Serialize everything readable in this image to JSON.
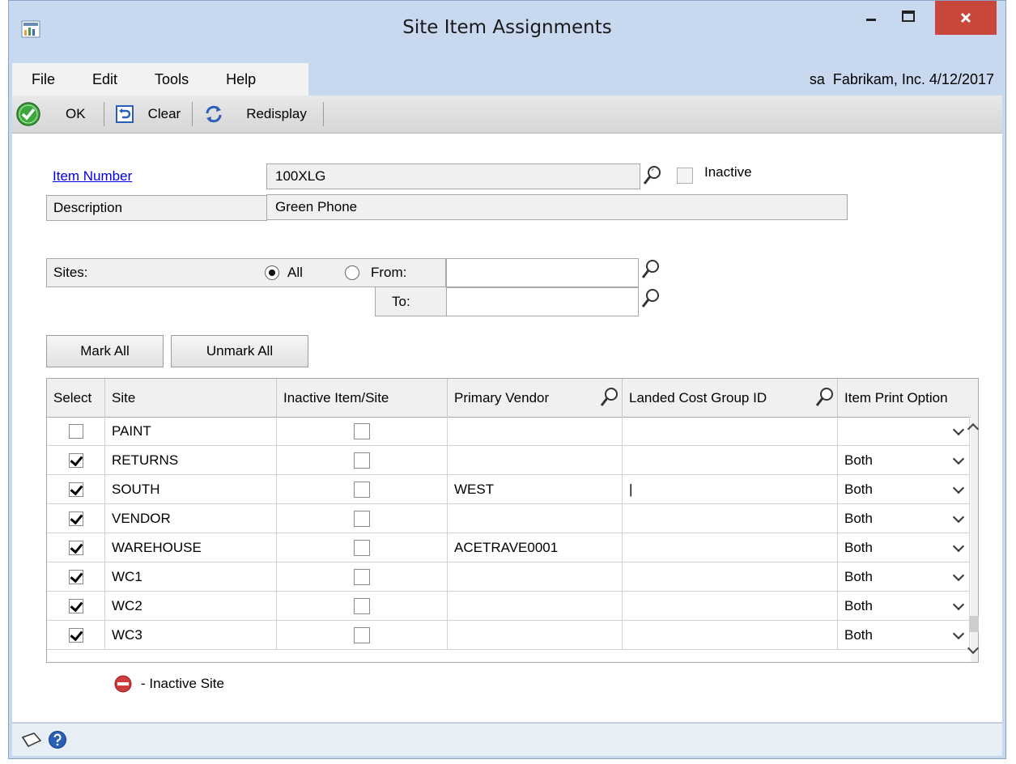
{
  "window": {
    "title": "Site Item Assignments"
  },
  "menu": {
    "items": [
      {
        "label": "File"
      },
      {
        "label": "Edit"
      },
      {
        "label": "Tools"
      },
      {
        "label": "Help"
      }
    ],
    "user_info": "sa  Fabrikam, Inc. 4/12/2017"
  },
  "toolbar": {
    "ok_label": "OK",
    "clear_label": "Clear",
    "redisplay_label": "Redisplay"
  },
  "form": {
    "item_number_label": "Item Number",
    "item_number_value": "100XLG",
    "inactive_label": "Inactive",
    "inactive_checked": false,
    "description_label": "Description",
    "description_value": "Green Phone",
    "sites_label": "Sites:",
    "all_label": "All",
    "from_label": "From:",
    "to_label": "To:",
    "from_value": "",
    "to_value": "",
    "sites_selected": "All"
  },
  "buttons": {
    "mark_all": "Mark All",
    "unmark_all": "Unmark All"
  },
  "grid": {
    "headers": {
      "select": "Select",
      "site": "Site",
      "inactive": "Inactive Item/Site",
      "vendor": "Primary Vendor",
      "landed": "Landed Cost Group ID",
      "print": "Item Print Option"
    },
    "rows": [
      {
        "checked": false,
        "site": "PAINT",
        "inactive": false,
        "vendor": "",
        "landed": "",
        "print": ""
      },
      {
        "checked": true,
        "site": "RETURNS",
        "inactive": false,
        "vendor": "",
        "landed": "",
        "print": "Both"
      },
      {
        "checked": true,
        "site": "SOUTH",
        "inactive": false,
        "vendor": "WEST",
        "landed": "|",
        "print": "Both"
      },
      {
        "checked": true,
        "site": "VENDOR",
        "inactive": false,
        "vendor": "",
        "landed": "",
        "print": "Both"
      },
      {
        "checked": true,
        "site": "WAREHOUSE",
        "inactive": false,
        "vendor": "ACETRAVE0001",
        "landed": "",
        "print": "Both"
      },
      {
        "checked": true,
        "site": "WC1",
        "inactive": false,
        "vendor": "",
        "landed": "",
        "print": "Both"
      },
      {
        "checked": true,
        "site": "WC2",
        "inactive": false,
        "vendor": "",
        "landed": "",
        "print": "Both"
      },
      {
        "checked": true,
        "site": "WC3",
        "inactive": false,
        "vendor": "",
        "landed": "",
        "print": "Both"
      }
    ]
  },
  "legend": {
    "label": "- Inactive Site"
  },
  "colors": {
    "window_frame": "#c7d8ef",
    "close_button": "#c8463a",
    "ok_green": "#3aa83a",
    "inactive_red": "#d23b3b",
    "help_blue": "#2a5fb8",
    "link": "#0000ee"
  },
  "icons": {
    "app": "app-icon",
    "ok": "checkmark-circle-icon",
    "clear": "undo-icon",
    "redisplay": "refresh-icon",
    "lookup": "magnifier-icon",
    "inactive_site": "no-entry-icon",
    "note": "note-icon",
    "help": "help-icon"
  }
}
